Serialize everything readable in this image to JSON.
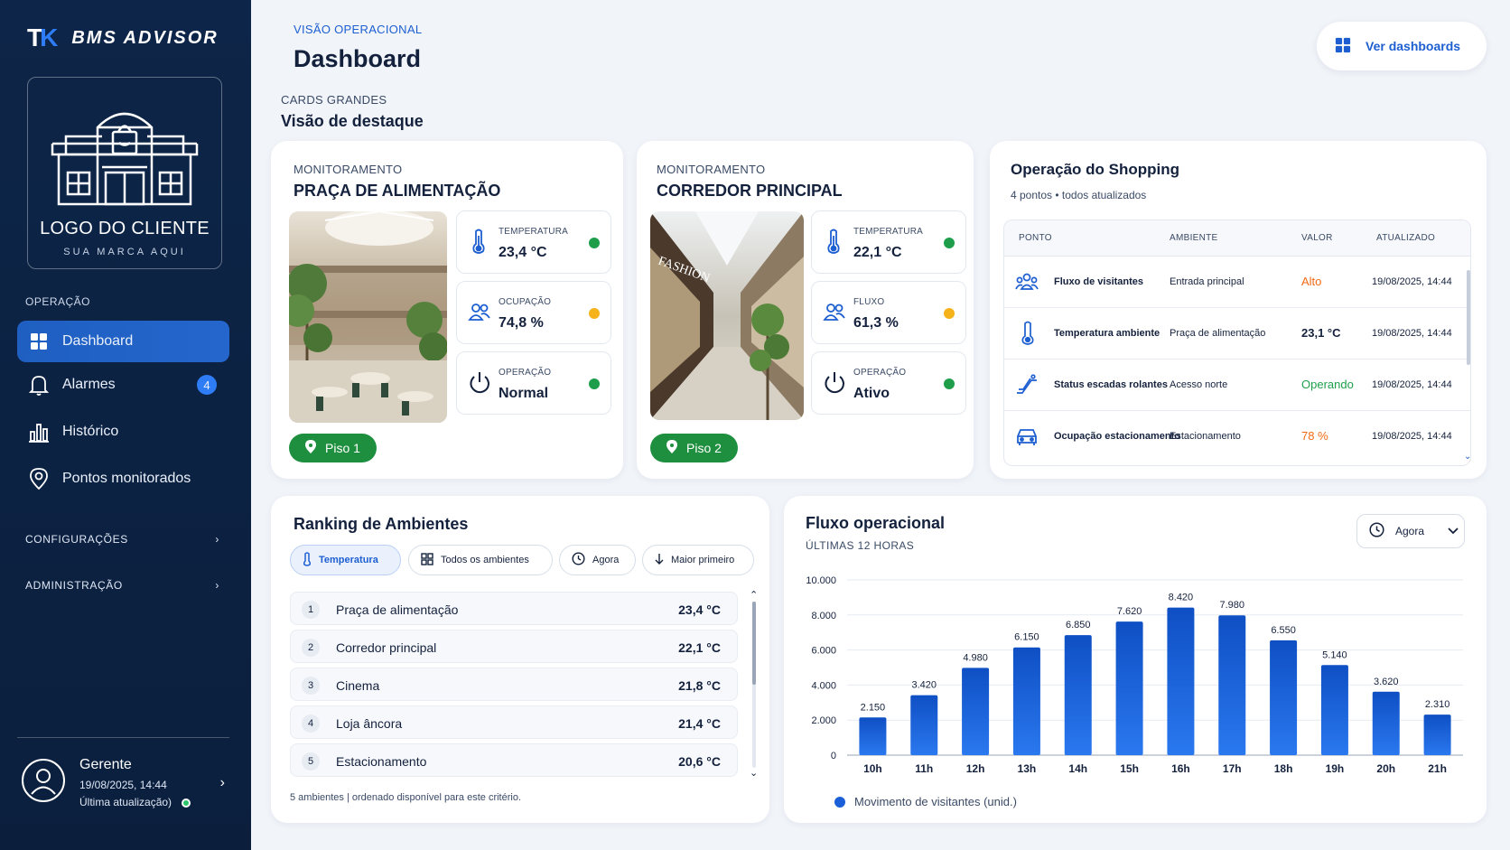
{
  "brand": {
    "mark_a": "T",
    "mark_b": "K",
    "name": "BMS ADVISOR"
  },
  "client_logo": {
    "title": "LOGO DO CLIENTE",
    "subtitle": "SUA MARCA AQUI"
  },
  "sidebar": {
    "section_operacao": "OPERAÇÃO",
    "items": [
      {
        "label": "Dashboard",
        "icon": "grid-icon",
        "active": true
      },
      {
        "label": "Alarmes",
        "icon": "bell-icon",
        "badge": "4"
      },
      {
        "label": "Histórico",
        "icon": "bar-chart-icon"
      },
      {
        "label": "Pontos monitorados",
        "icon": "location-pin-icon"
      }
    ],
    "configuracoes": "CONFIGURAÇÕES",
    "administracao": "ADMINISTRAÇÃO",
    "user": {
      "name": "Gerente",
      "datetime": "19/08/2025, 14:44",
      "update_label": "Última atualização)"
    }
  },
  "header": {
    "kicker": "VISÃO OPERACIONAL",
    "title": "Dashboard",
    "button": "Ver dashboards"
  },
  "section": {
    "kicker": "CARDS GRANDES",
    "title": "Visão de destaque"
  },
  "monitor_cards": [
    {
      "kicker": "MONITORAMENTO",
      "title": "PRAÇA DE ALIMENTAÇÃO",
      "floor": "Piso 1",
      "metrics": [
        {
          "label": "TEMPERATURA",
          "value": "23,4 °C",
          "status_color": "#1e9e4a",
          "icon": "thermometer-icon"
        },
        {
          "label": "OCUPAÇÃO",
          "value": "74,8 %",
          "status_color": "#f5b21b",
          "icon": "people-icon"
        },
        {
          "label": "OPERAÇÃO",
          "value": "Normal",
          "status_color": "#1e9e4a",
          "icon": "power-icon"
        }
      ]
    },
    {
      "kicker": "MONITORAMENTO",
      "title": "CORREDOR PRINCIPAL",
      "floor": "Piso 2",
      "metrics": [
        {
          "label": "TEMPERATURA",
          "value": "22,1 °C",
          "status_color": "#1e9e4a",
          "icon": "thermometer-icon"
        },
        {
          "label": "FLUXO",
          "value": "61,3 %",
          "status_color": "#f5b21b",
          "icon": "people-icon"
        },
        {
          "label": "OPERAÇÃO",
          "value": "Ativo",
          "status_color": "#1e9e4a",
          "icon": "power-icon"
        }
      ]
    }
  ],
  "operacao": {
    "title": "Operação do Shopping",
    "subtitle": "4 pontos • todos atualizados",
    "columns": [
      "PONTO",
      "AMBIENTE",
      "VALOR",
      "ATUALIZADO"
    ],
    "rows": [
      {
        "ponto": "Fluxo de visitantes",
        "ambiente": "Entrada principal",
        "valor": "Alto",
        "valor_color": "#f06a14",
        "atualizado": "19/08/2025, 14:44",
        "icon": "group-icon"
      },
      {
        "ponto": "Temperatura ambiente",
        "ambiente": "Praça de alimentação",
        "valor": "23,1 °C",
        "valor_color": "#14213d",
        "atualizado": "19/08/2025, 14:44",
        "icon": "thermometer-icon"
      },
      {
        "ponto": "Status escadas rolantes",
        "ambiente": "Acesso norte",
        "valor": "Operando",
        "valor_color": "#1e9e4a",
        "atualizado": "19/08/2025, 14:44",
        "icon": "escalator-icon"
      },
      {
        "ponto": "Ocupação estacionamento",
        "ambiente": "Estacionamento",
        "valor": "78 %",
        "valor_color": "#f06a14",
        "atualizado": "19/08/2025, 14:44",
        "icon": "car-icon"
      }
    ]
  },
  "ranking": {
    "title": "Ranking de Ambientes",
    "chips": [
      "Temperatura",
      "Todos os ambientes",
      "Agora",
      "Maior primeiro"
    ],
    "rows": [
      {
        "rank": "1",
        "label": "Praça de alimentação",
        "value": "23,4 °C"
      },
      {
        "rank": "2",
        "label": "Corredor principal",
        "value": "22,1 °C"
      },
      {
        "rank": "3",
        "label": "Cinema",
        "value": "21,8 °C"
      },
      {
        "rank": "4",
        "label": "Loja âncora",
        "value": "21,4 °C"
      },
      {
        "rank": "5",
        "label": "Estacionamento",
        "value": "20,6 °C"
      }
    ],
    "footer": "5 ambientes | ordenado disponível para este critério."
  },
  "fluxo": {
    "title": "Fluxo operacional",
    "subtitle": "ÚLTIMAS 12 HORAS",
    "select": "Agora",
    "legend": "Movimento de visitantes (unid.)"
  },
  "colors": {
    "accent": "#1d5fd1",
    "bar": "#1a5fd8",
    "ok": "#1e9e4a",
    "warn": "#f5b21b"
  },
  "chart_data": {
    "type": "bar",
    "title": "Fluxo operacional",
    "categories": [
      "10h",
      "11h",
      "12h",
      "13h",
      "14h",
      "15h",
      "16h",
      "17h",
      "18h",
      "19h",
      "20h",
      "21h"
    ],
    "series": [
      {
        "name": "Movimento de visitantes (unid.)",
        "values": [
          2150,
          3420,
          4980,
          6150,
          6850,
          7620,
          8420,
          7980,
          6550,
          5140,
          3620,
          2310
        ]
      }
    ],
    "value_labels": [
      "2.150",
      "3.420",
      "4.980",
      "6.150",
      "6.850",
      "7.620",
      "8.420",
      "7.980",
      "6.550",
      "5.140",
      "3.620",
      "2.310"
    ],
    "yticks": [
      "0",
      "2.000",
      "4.000",
      "6.000",
      "8.000",
      "10.000"
    ],
    "ylim": [
      0,
      10000
    ],
    "grid": true,
    "legend_position": "bottom-left"
  }
}
